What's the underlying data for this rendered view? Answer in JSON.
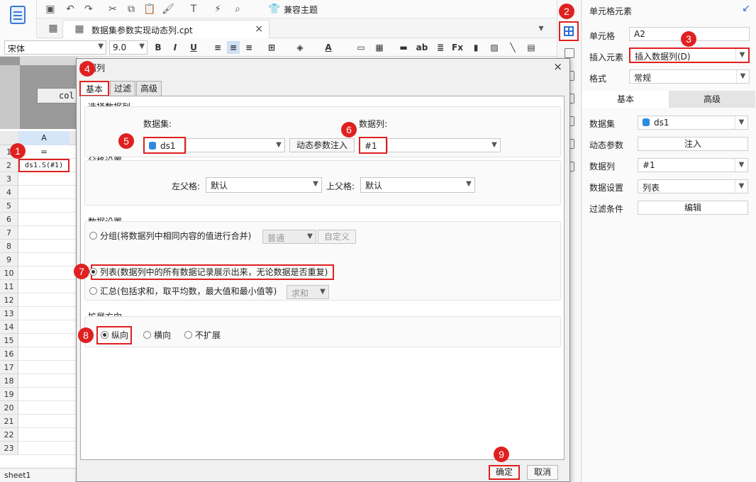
{
  "toolbar": {
    "theme_label": "兼容主题"
  },
  "file_tab": {
    "name": "数据集参数实现动态列.cpt",
    "close": "×"
  },
  "format": {
    "font": "宋体",
    "size": "9.0",
    "bold": "B",
    "italic": "I",
    "underline": "U"
  },
  "sheet": {
    "col_label": "col:",
    "col_header": "A",
    "rows": [
      "1",
      "2",
      "3",
      "4",
      "5",
      "6",
      "7",
      "8",
      "9",
      "10",
      "11",
      "12",
      "13",
      "14",
      "15",
      "16",
      "17",
      "18",
      "19",
      "20",
      "21",
      "22",
      "23"
    ],
    "cell_a1": "=",
    "cell_a2": "ds1.S(#1)",
    "sheet_tab": "sheet1"
  },
  "panel": {
    "title": "单元格元素",
    "cell_label": "单元格",
    "cell_value": "A2",
    "insert_label": "插入元素",
    "insert_value": "插入数据列(D)",
    "format_label": "格式",
    "format_value": "常规",
    "tab_basic": "基本",
    "tab_advanced": "高级",
    "dataset_label": "数据集",
    "dataset_value": "ds1",
    "dynamic_label": "动态参数",
    "dynamic_btn": "注入",
    "column_label": "数据列",
    "column_value": "#1",
    "data_setting_label": "数据设置",
    "data_setting_value": "列表",
    "filter_label": "过滤条件",
    "filter_btn": "编辑"
  },
  "dialog": {
    "title": "数据列",
    "close": "×",
    "tabs": [
      "基本",
      "过滤",
      "高级"
    ],
    "select_section": "选择数据列",
    "dataset_label": "数据集:",
    "dataset_value": "ds1",
    "dynamic_btn": "动态参数注入",
    "column_label": "数据列:",
    "column_value": "#1",
    "parent_section": "父格设置",
    "left_parent_label": "左父格:",
    "left_parent_value": "默认",
    "top_parent_label": "上父格:",
    "top_parent_value": "默认",
    "data_section": "数据设置",
    "group_option": "分组(将数据列中相同内容的值进行合并)",
    "group_select": "普通",
    "group_custom": "自定义",
    "list_option": "列表(数据列中的所有数据记录展示出来，无论数据是否重复)",
    "summary_option": "汇总(包括求和，取平均数，最大值和最小值等)",
    "summary_select": "求和",
    "expand_section": "扩展方向",
    "vertical": "纵向",
    "horizontal": "横向",
    "no_expand": "不扩展",
    "ok": "确定",
    "cancel": "取消"
  },
  "markers": [
    "1",
    "2",
    "3",
    "4",
    "5",
    "6",
    "7",
    "8",
    "9"
  ],
  "colors": {
    "accent": "#2b6fd6",
    "highlight": "#e02020"
  }
}
